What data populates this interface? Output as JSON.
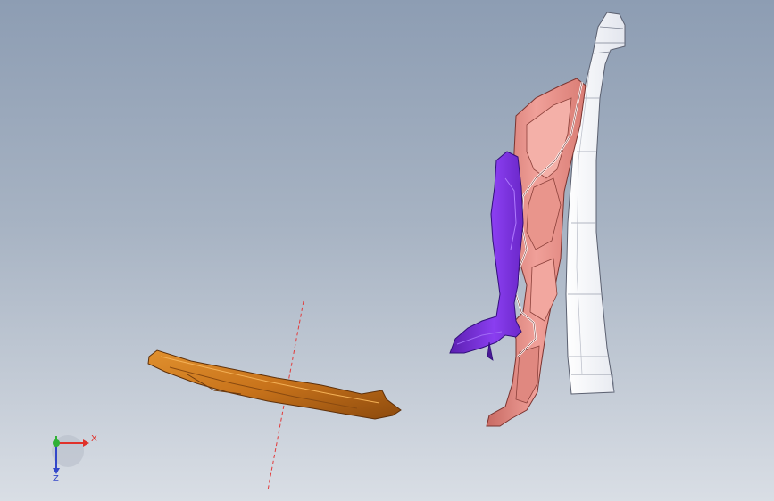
{
  "viewport": {
    "background_top": "#8d9db3",
    "background_bottom": "#d9dee5"
  },
  "triad": {
    "x_label": "X",
    "z_label": "Z",
    "x_color": "#e0312a",
    "y_color": "#2fb135",
    "z_color": "#3247c9"
  },
  "parts": {
    "beam_color": "#c8731b",
    "panel_color": "#e88f86",
    "bracket_color": "#7a2fd3",
    "pillar_color": "#f7f8fb",
    "sketch_line_color": "#e23b3b"
  }
}
